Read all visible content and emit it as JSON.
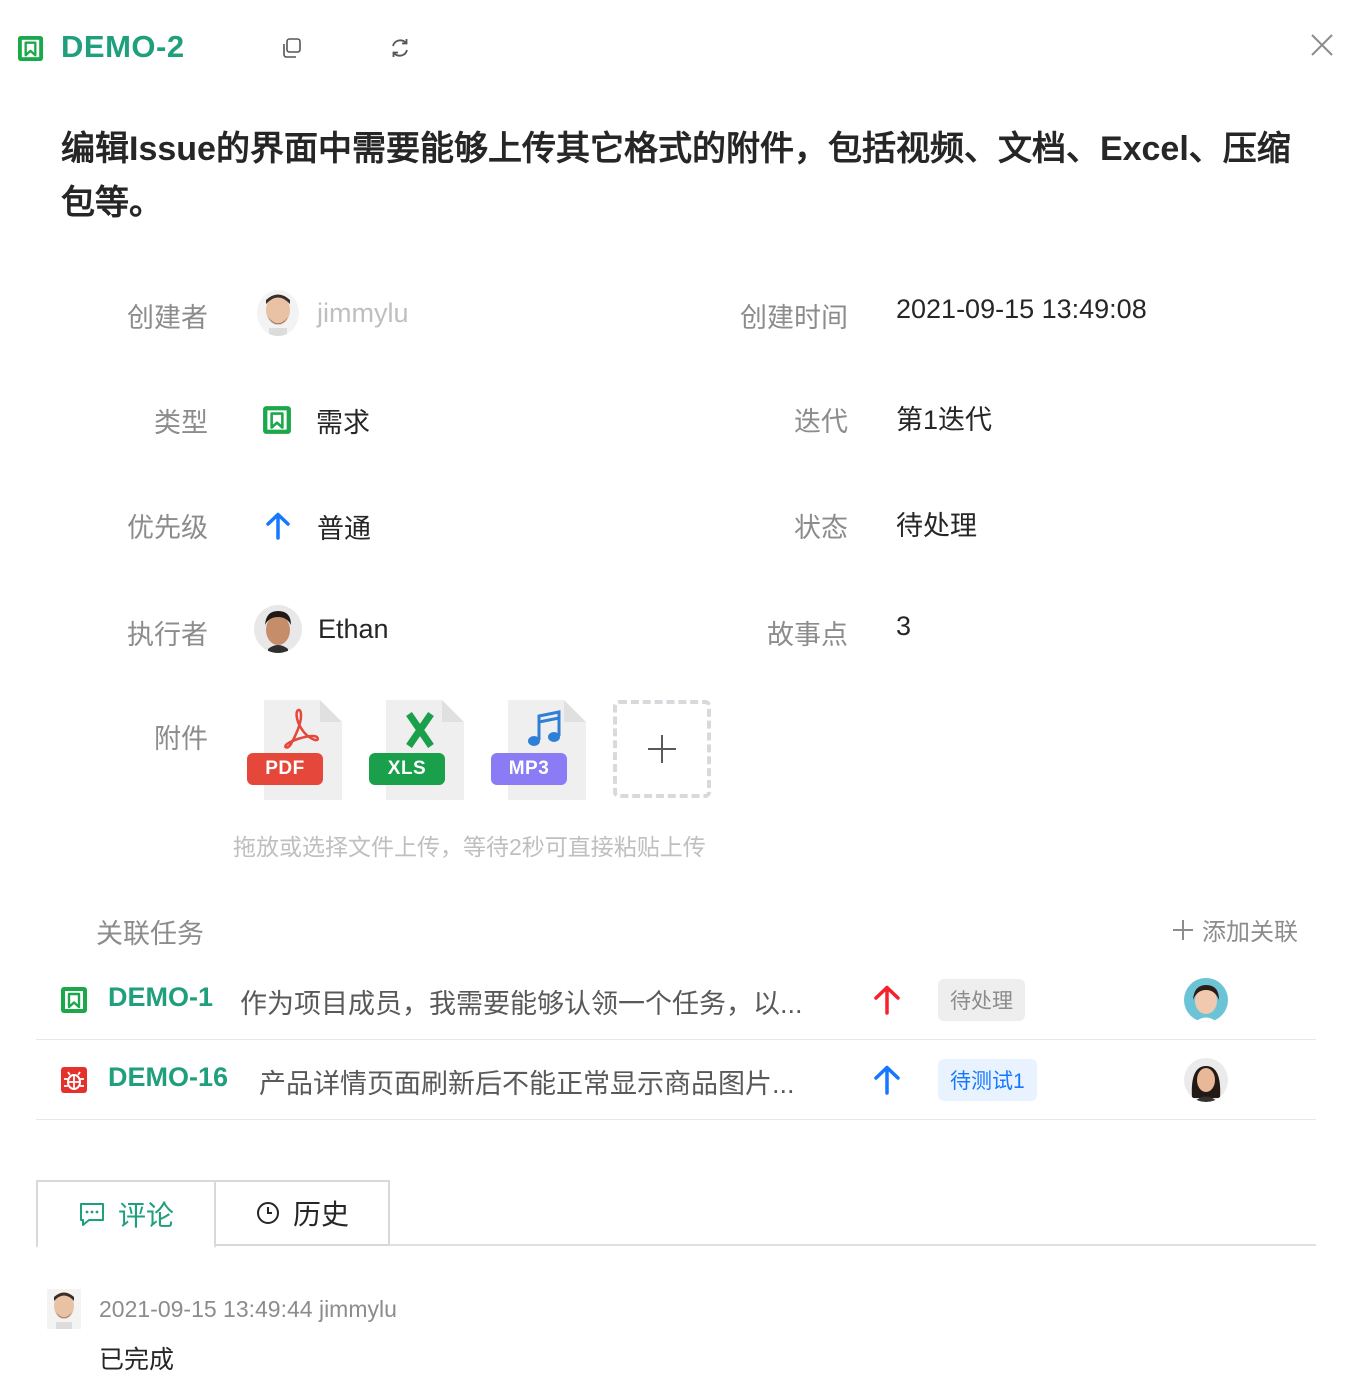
{
  "header": {
    "issue_key": "DEMO-2",
    "copy_label": "copy-icon",
    "refresh_label": "refresh-icon",
    "close_label": "close-icon",
    "accent_color": "#1f9f7b"
  },
  "title": "编辑Issue的界面中需要能够上传其它格式的附件，包括视频、文档、Excel、压缩包等。",
  "fields": {
    "creator_label": "创建者",
    "creator_value": "jimmylu",
    "created_time_label": "创建时间",
    "created_time_value": "2021-09-15 13:49:08",
    "type_label": "类型",
    "type_value": "需求",
    "iteration_label": "迭代",
    "iteration_value": "第1迭代",
    "priority_label": "优先级",
    "priority_value": "普通",
    "status_label": "状态",
    "status_value": "待处理",
    "assignee_label": "执行者",
    "assignee_value": "Ethan",
    "story_points_label": "故事点",
    "story_points_value": "3",
    "attachments_label": "附件"
  },
  "attachments": {
    "files": [
      {
        "badge": "PDF",
        "color": "#e5473b",
        "icon": "pdf-icon"
      },
      {
        "badge": "XLS",
        "color": "#1aa04a",
        "icon": "excel-icon"
      },
      {
        "badge": "MP3",
        "color": "#8b7cf6",
        "icon": "music-icon"
      }
    ],
    "hint": "拖放或选择文件上传，等待2秒可直接粘贴上传"
  },
  "related": {
    "section_title": "关联任务",
    "add_label": "添加关联",
    "tasks": [
      {
        "key": "DEMO-1",
        "title": "作为项目成员，我需要能够认领一个任务，以...",
        "status": "待处理",
        "status_bg": "#eeeeee",
        "status_color": "#8c8c8c",
        "priority_color": "#f5222d",
        "type_icon": "story-bookmark-icon"
      },
      {
        "key": "DEMO-16",
        "title": "产品详情页面刷新后不能正常显示商品图片...",
        "status": "待测试1",
        "status_bg": "#e9f3ff",
        "status_color": "#1677ff",
        "priority_color": "#1677ff",
        "type_icon": "bug-icon"
      }
    ]
  },
  "tabs": {
    "comments": "评论",
    "history": "历史"
  },
  "comment": {
    "meta": "2021-09-15 13:49:44 jimmylu",
    "body": "已完成"
  }
}
